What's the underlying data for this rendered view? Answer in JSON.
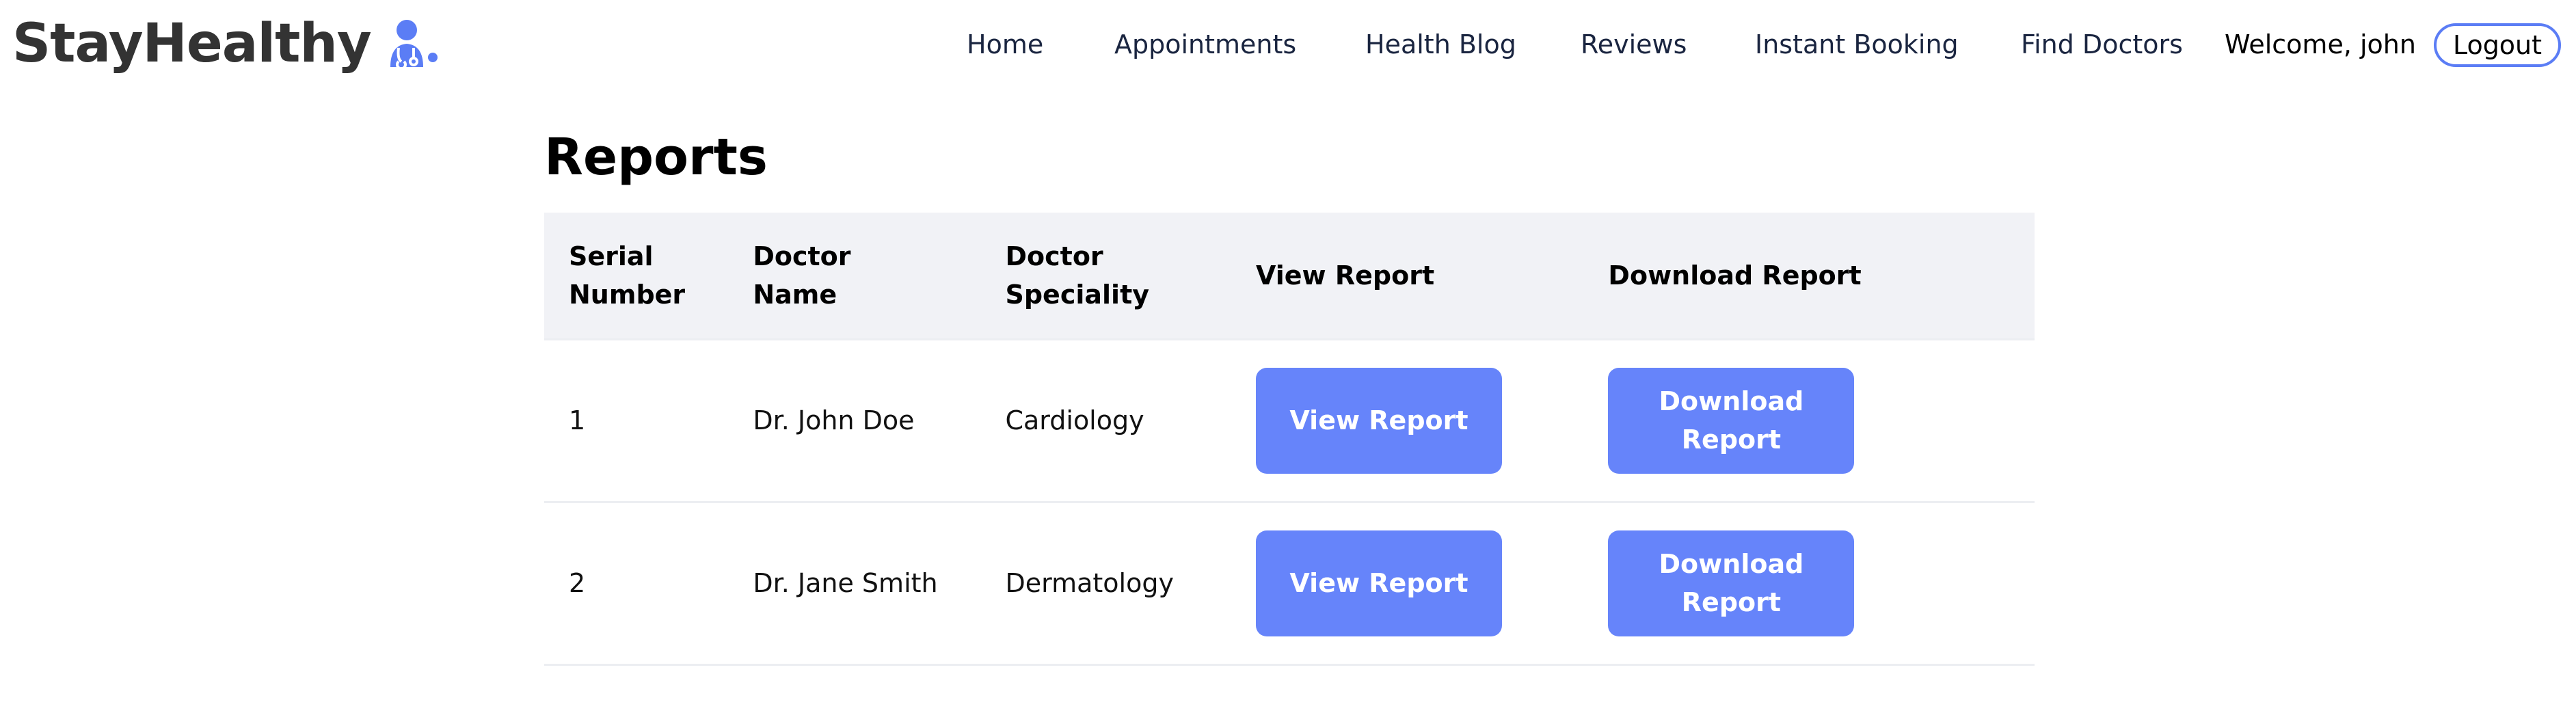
{
  "brand": {
    "name": "StayHealthy",
    "icon": "doctor-icon",
    "icon_color": "#5b7df5"
  },
  "nav": {
    "links": [
      {
        "label": "Home"
      },
      {
        "label": "Appointments"
      },
      {
        "label": "Health Blog"
      },
      {
        "label": "Reviews"
      },
      {
        "label": "Instant Booking"
      },
      {
        "label": "Find Doctors"
      }
    ],
    "welcome": "Welcome, john",
    "logout_label": "Logout"
  },
  "page": {
    "title": "Reports"
  },
  "table": {
    "headers": [
      "Serial Number",
      "Doctor Name",
      "Doctor Speciality",
      "View Report",
      "Download Report"
    ],
    "rows": [
      {
        "serial": "1",
        "doctor_name": "Dr. John Doe",
        "speciality": "Cardiology",
        "view_label": "View Report",
        "download_label": "Download Report"
      },
      {
        "serial": "2",
        "doctor_name": "Dr. Jane Smith",
        "speciality": "Dermatology",
        "view_label": "View Report",
        "download_label": "Download Report"
      }
    ]
  },
  "colors": {
    "accent": "#6684fa",
    "header_bg": "#f1f2f6",
    "logout_border": "#5b7df5"
  }
}
